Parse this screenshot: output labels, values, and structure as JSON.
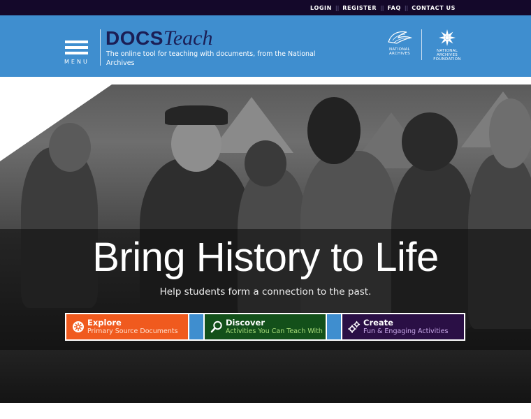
{
  "topnav": {
    "items": [
      "LOGIN",
      "REGISTER",
      "FAQ",
      "CONTACT US"
    ],
    "separator": "||"
  },
  "header": {
    "menu_label": "MENU",
    "logo_docs": "DOCS",
    "logo_teach": "Teach",
    "tagline": "The online tool for teaching with documents, from the National Archives",
    "partner_na": "NATIONAL ARCHIVES",
    "partner_naf": "NATIONAL ARCHIVES FOUNDATION"
  },
  "hero": {
    "title": "Bring History to Life",
    "subtitle": "Help students form a connection to the past.",
    "ctas": [
      {
        "title": "Explore",
        "subtitle": "Primary Source Documents",
        "color": "#f05a1e"
      },
      {
        "title": "Discover",
        "subtitle": "Activities You Can Teach With",
        "color": "#13501a"
      },
      {
        "title": "Create",
        "subtitle": "Fun & Engaging Activities",
        "color": "#2a0f45"
      }
    ]
  },
  "colors": {
    "topbar": "#14082a",
    "header": "#3f8ecf",
    "logo": "#1b1e55"
  },
  "icons": {
    "explore": "compass-icon",
    "discover": "magnifier-icon",
    "create": "gears-icon"
  }
}
